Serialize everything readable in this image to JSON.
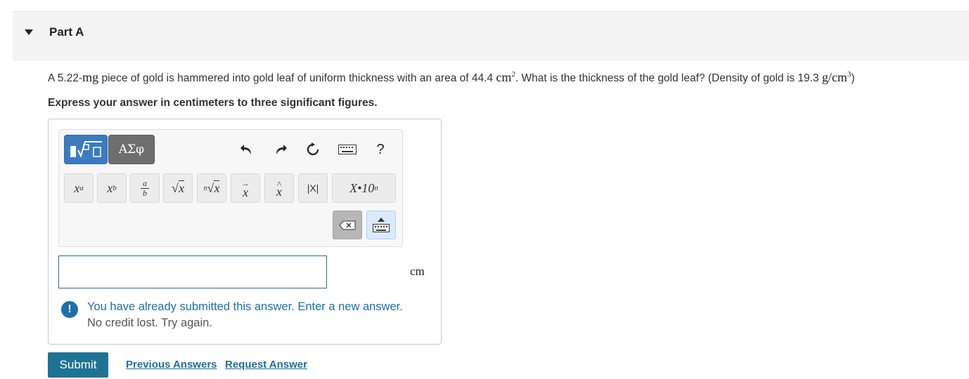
{
  "part": {
    "title": "Part A"
  },
  "question": {
    "prefix": "A 5.22-",
    "mass_unit": "mg",
    "middle": " piece of gold is hammered into gold leaf of uniform thickness with an area of 44.4 ",
    "area_unit": "cm",
    "area_exp": "2",
    "after_area": ". What is the thickness of the gold leaf? (Density of gold is 19.3 ",
    "density_unit": "g/cm",
    "density_exp": "3",
    "suffix": ")"
  },
  "instruction": "Express your answer in centimeters to three significant figures.",
  "toolbar": {
    "templates_tab": "templates",
    "symbols_tab": "ΑΣφ",
    "icons": [
      "undo-icon",
      "redo-icon",
      "reset-icon",
      "keyboard-icon",
      "help-icon"
    ],
    "help_label": "?",
    "keys": {
      "superscript_base": "x",
      "superscript_exp": "a",
      "subscript_base": "x",
      "subscript_sub": "b",
      "fraction_num": "a",
      "fraction_den": "b",
      "sqrt_body": "x",
      "nthroot_index": "n",
      "nthroot_body": "x",
      "vector_body": "x",
      "vector_mark": "→",
      "hat_body": "x",
      "hat_mark": "^",
      "abs_value": "|X|",
      "sci_notation": "X•10",
      "sci_exp": "n"
    }
  },
  "answer": {
    "value": "",
    "unit": "cm"
  },
  "feedback": {
    "icon_label": "!",
    "message": "You have already submitted this answer. Enter a new answer.",
    "submessage": "No credit lost. Try again."
  },
  "actions": {
    "submit": "Submit",
    "previous_answers": "Previous Answers",
    "request_answer": "Request Answer"
  },
  "colors": {
    "accent": "#1e7394",
    "link": "#1e6f9a",
    "feedback_text": "#1d6fa5",
    "templates_tab": "#3c7bc0"
  }
}
